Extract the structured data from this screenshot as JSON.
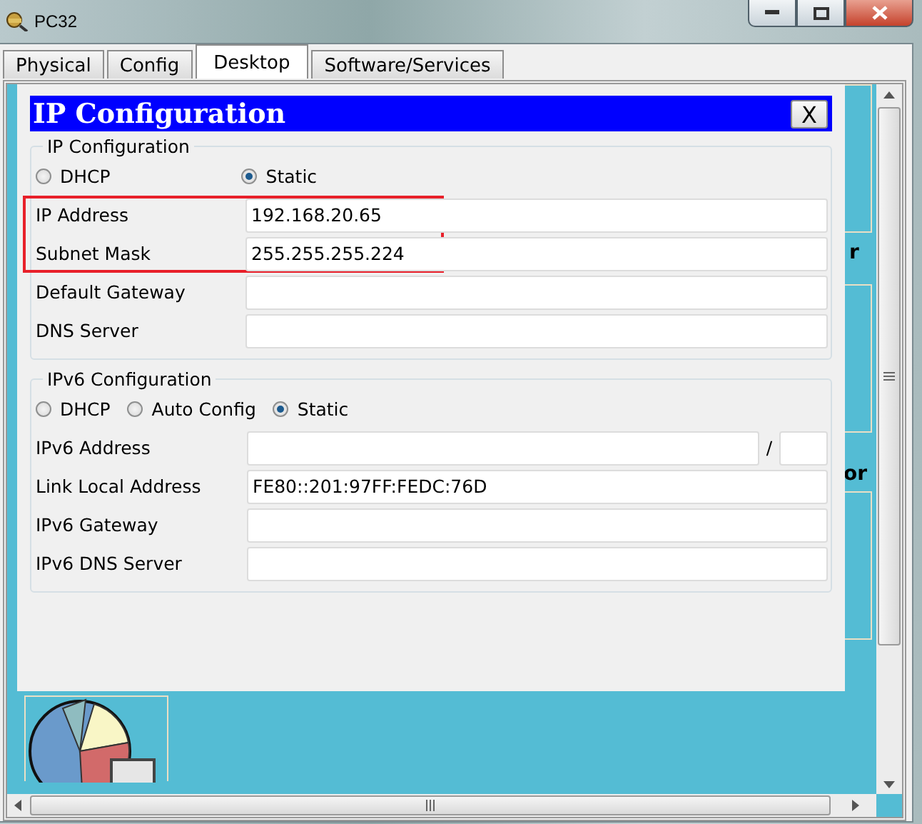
{
  "window": {
    "title": "PC32"
  },
  "tabs": [
    {
      "label": "Physical",
      "selected": false
    },
    {
      "label": "Config",
      "selected": false
    },
    {
      "label": "Desktop",
      "selected": true
    },
    {
      "label": "Software/Services",
      "selected": false
    }
  ],
  "background_fragments": [
    "r",
    "or"
  ],
  "dialog": {
    "title": "IP Configuration",
    "close": "X",
    "ipv4": {
      "legend": "IP Configuration",
      "modes": [
        {
          "label": "DHCP",
          "selected": false
        },
        {
          "label": "Static",
          "selected": true
        }
      ],
      "fields": [
        {
          "label": "IP Address",
          "value": "192.168.20.65",
          "highlighted": true
        },
        {
          "label": "Subnet Mask",
          "value": "255.255.255.224",
          "highlighted": true
        },
        {
          "label": "Default Gateway",
          "highlighted": false
        },
        {
          "label": "DNS Server",
          "highlighted": false
        }
      ]
    },
    "ipv6": {
      "legend": "IPv6 Configuration",
      "modes": [
        {
          "label": "DHCP",
          "selected": false
        },
        {
          "label": "Auto Config",
          "selected": false
        },
        {
          "label": "Static",
          "selected": true
        }
      ],
      "fields": [
        {
          "label": "IPv6 Address",
          "kind": "prefix",
          "separator": "/"
        },
        {
          "label": "Link Local Address",
          "value": "FE80::201:97FF:FEDC:76D",
          "kind": "plain"
        },
        {
          "label": "IPv6 Gateway",
          "kind": "plain"
        },
        {
          "label": "IPv6 DNS Server",
          "kind": "plain"
        }
      ]
    }
  }
}
